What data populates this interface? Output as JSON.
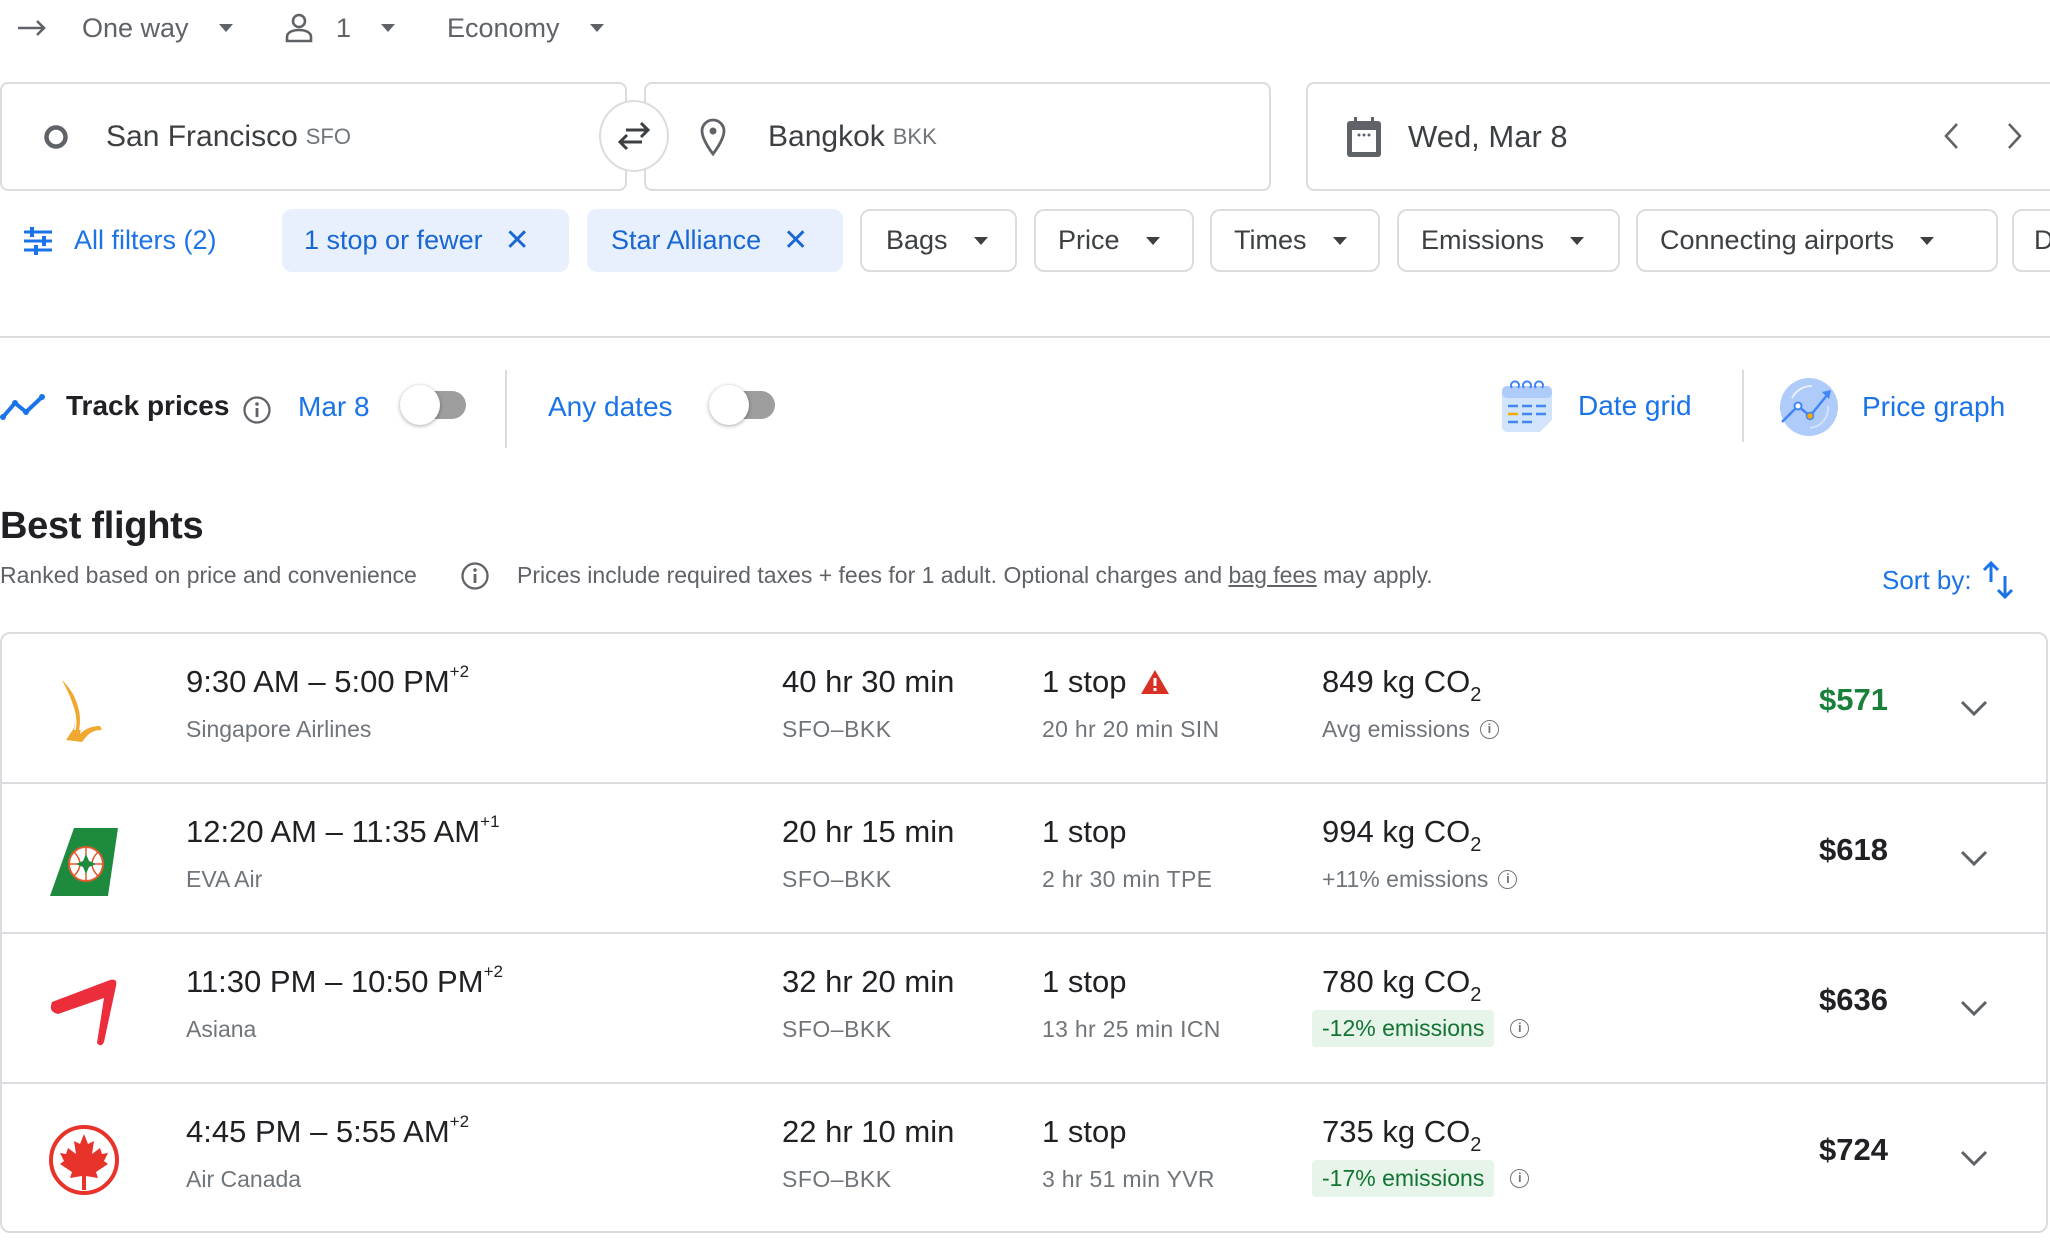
{
  "search": {
    "trip_type": "One way",
    "passengers": "1",
    "cabin_class": "Economy",
    "origin": {
      "city": "San Francisco",
      "code": "SFO"
    },
    "destination": {
      "city": "Bangkok",
      "code": "BKK"
    },
    "date": "Wed, Mar 8"
  },
  "filters": {
    "all_filters": "All filters (2)",
    "active": [
      {
        "label": "1 stop or fewer"
      },
      {
        "label": "Star Alliance"
      }
    ],
    "dropdowns": [
      {
        "label": "Bags"
      },
      {
        "label": "Price"
      },
      {
        "label": "Times"
      },
      {
        "label": "Emissions"
      },
      {
        "label": "Connecting airports"
      },
      {
        "label": "D"
      }
    ]
  },
  "tracking": {
    "track_label": "Track prices",
    "date_label": "Mar 8",
    "date_toggle_on": false,
    "any_dates_label": "Any dates",
    "any_dates_toggle_on": false,
    "date_grid": "Date grid",
    "price_graph": "Price graph"
  },
  "results": {
    "title": "Best flights",
    "ranked_note": "Ranked based on price and convenience",
    "price_note_prefix": "Prices include required taxes + fees for 1 adult. Optional charges and ",
    "price_note_link": "bag fees",
    "price_note_suffix": " may apply.",
    "sort_label": "Sort by:",
    "flights": [
      {
        "depart": "9:30 AM",
        "arrive": "5:00 PM",
        "day_offset": "+2",
        "airline": "Singapore Airlines",
        "duration": "40 hr 30 min",
        "route": "SFO–BKK",
        "stops": "1 stop",
        "warning": true,
        "layover": "20 hr 20 min SIN",
        "co2_value": "849 kg CO",
        "co2_sub": "2",
        "emissions_note": "Avg emissions",
        "emissions_good": false,
        "price": "$571",
        "price_best": true
      },
      {
        "depart": "12:20 AM",
        "arrive": "11:35 AM",
        "day_offset": "+1",
        "airline": "EVA Air",
        "duration": "20 hr 15 min",
        "route": "SFO–BKK",
        "stops": "1 stop",
        "warning": false,
        "layover": "2 hr 30 min TPE",
        "co2_value": "994 kg CO",
        "co2_sub": "2",
        "emissions_note": "+11% emissions",
        "emissions_good": false,
        "price": "$618",
        "price_best": false
      },
      {
        "depart": "11:30 PM",
        "arrive": "10:50 PM",
        "day_offset": "+2",
        "airline": "Asiana",
        "duration": "32 hr 20 min",
        "route": "SFO–BKK",
        "stops": "1 stop",
        "warning": false,
        "layover": "13 hr 25 min ICN",
        "co2_value": "780 kg CO",
        "co2_sub": "2",
        "emissions_note": "-12% emissions",
        "emissions_good": true,
        "price": "$636",
        "price_best": false
      },
      {
        "depart": "4:45 PM",
        "arrive": "5:55 AM",
        "day_offset": "+2",
        "airline": "Air Canada",
        "duration": "22 hr 10 min",
        "route": "SFO–BKK",
        "stops": "1 stop",
        "warning": false,
        "layover": "3 hr 51 min YVR",
        "co2_value": "735 kg CO",
        "co2_sub": "2",
        "emissions_note": "-17% emissions",
        "emissions_good": true,
        "price": "$724",
        "price_best": false
      }
    ]
  },
  "colors": {
    "accent_blue": "#1a73e8",
    "chip_selected_bg": "#e8f0fe",
    "best_price_green": "#188038",
    "emissions_good_bg": "#e6f4ea",
    "emissions_good_text": "#137333",
    "warning_red": "#d93025"
  }
}
